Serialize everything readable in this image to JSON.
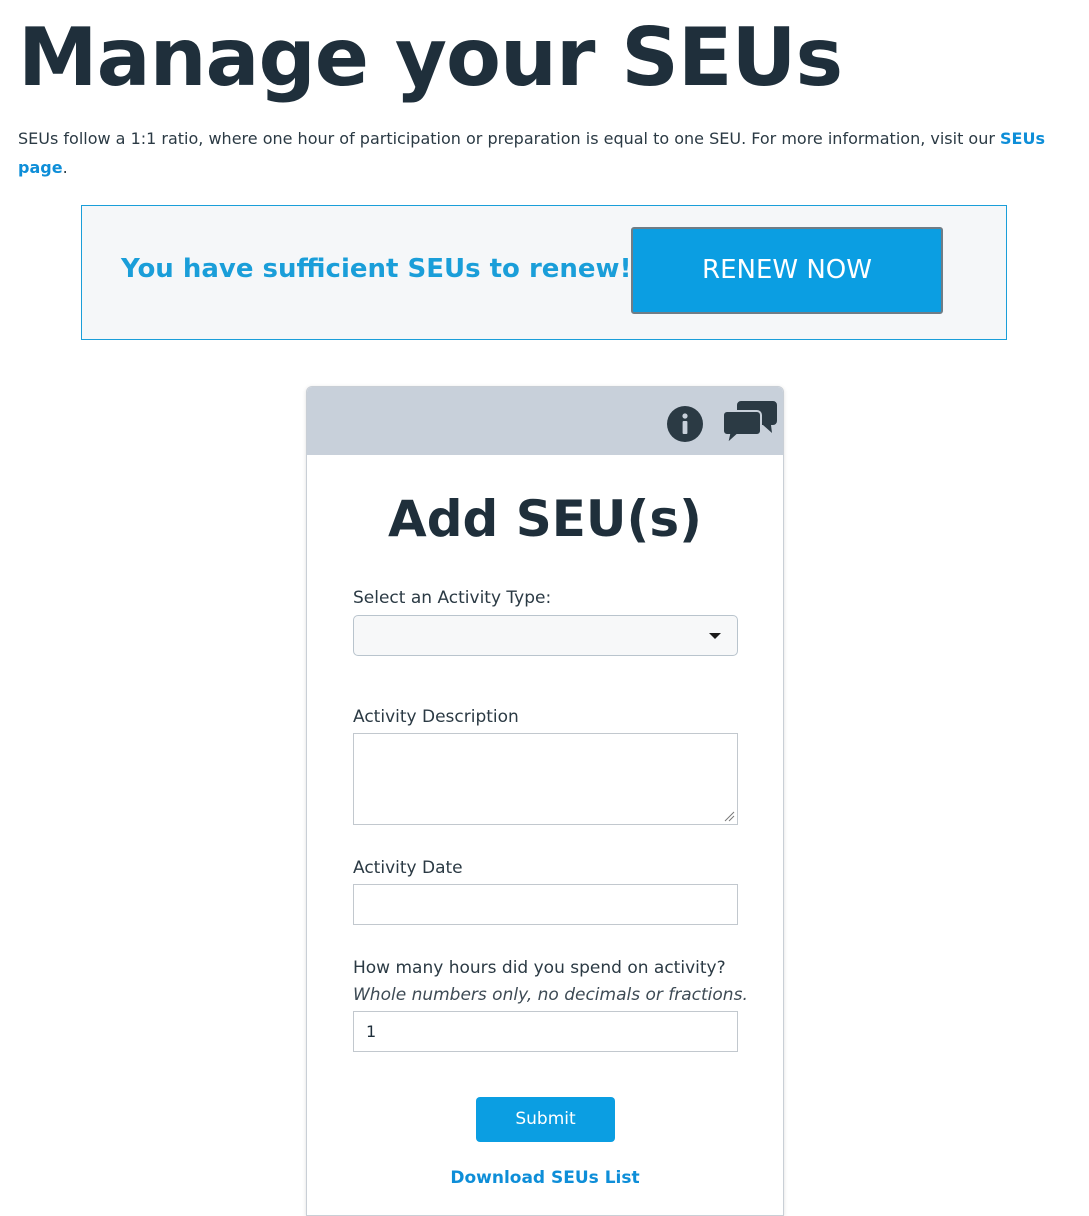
{
  "page": {
    "title": "Manage your SEUs",
    "intro_text": "SEUs follow a 1:1 ratio, where one hour of participation or preparation is equal to one SEU. For more information, visit our ",
    "intro_link": "SEUs page",
    "intro_end": "."
  },
  "renew": {
    "message": "You have sufficient SEUs to renew!",
    "button_label": "RENEW NOW"
  },
  "widget": {
    "icons": [
      "info-icon",
      "chat-icon"
    ],
    "title": "Add SEU(s)",
    "activity_type_label": "Select an Activity Type:",
    "activity_type_value": "",
    "description_label": "Activity Description",
    "description_value": "",
    "date_label": "Activity Date",
    "date_value": "",
    "hours_label": "How many hours did you spend on activity?",
    "hours_hint": "Whole numbers only, no decimals or fractions.",
    "hours_value": "1",
    "submit_label": "Submit",
    "download_label": "Download SEUs List"
  },
  "colors": {
    "accent": "#0b9ee2",
    "link": "#0e8ed8",
    "heading": "#1f2f3b",
    "widget_header": "#c8d0da"
  }
}
